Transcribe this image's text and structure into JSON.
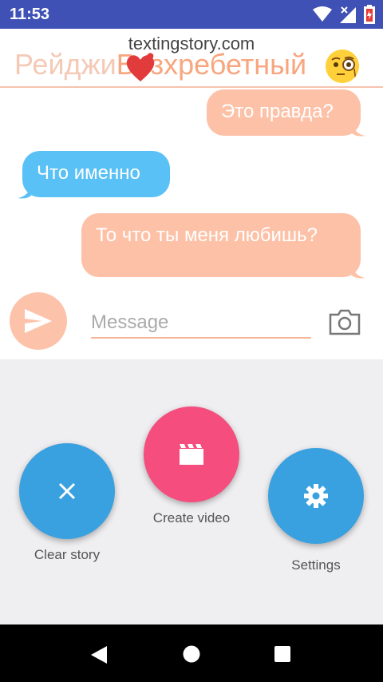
{
  "status_bar": {
    "time": "11:53"
  },
  "header": {
    "watermark": "textingstory.com",
    "contact_name_part1": "Рейджи",
    "contact_name_part2": "Безхребетный"
  },
  "messages": [
    {
      "direction": "out",
      "text": "Это правда?"
    },
    {
      "direction": "in",
      "text": "Что именно"
    },
    {
      "direction": "out",
      "text": "То что ты меня любишь?"
    }
  ],
  "composer": {
    "placeholder": "Message"
  },
  "actions": {
    "clear_story": "Clear story",
    "create_video": "Create video",
    "settings": "Settings"
  },
  "colors": {
    "status_bar": "#3f51b5",
    "outgoing_bubble": "#fcc1a7",
    "incoming_bubble": "#5ac1f6",
    "fab_blue": "#3aa1e0",
    "fab_pink": "#f44d7e"
  }
}
